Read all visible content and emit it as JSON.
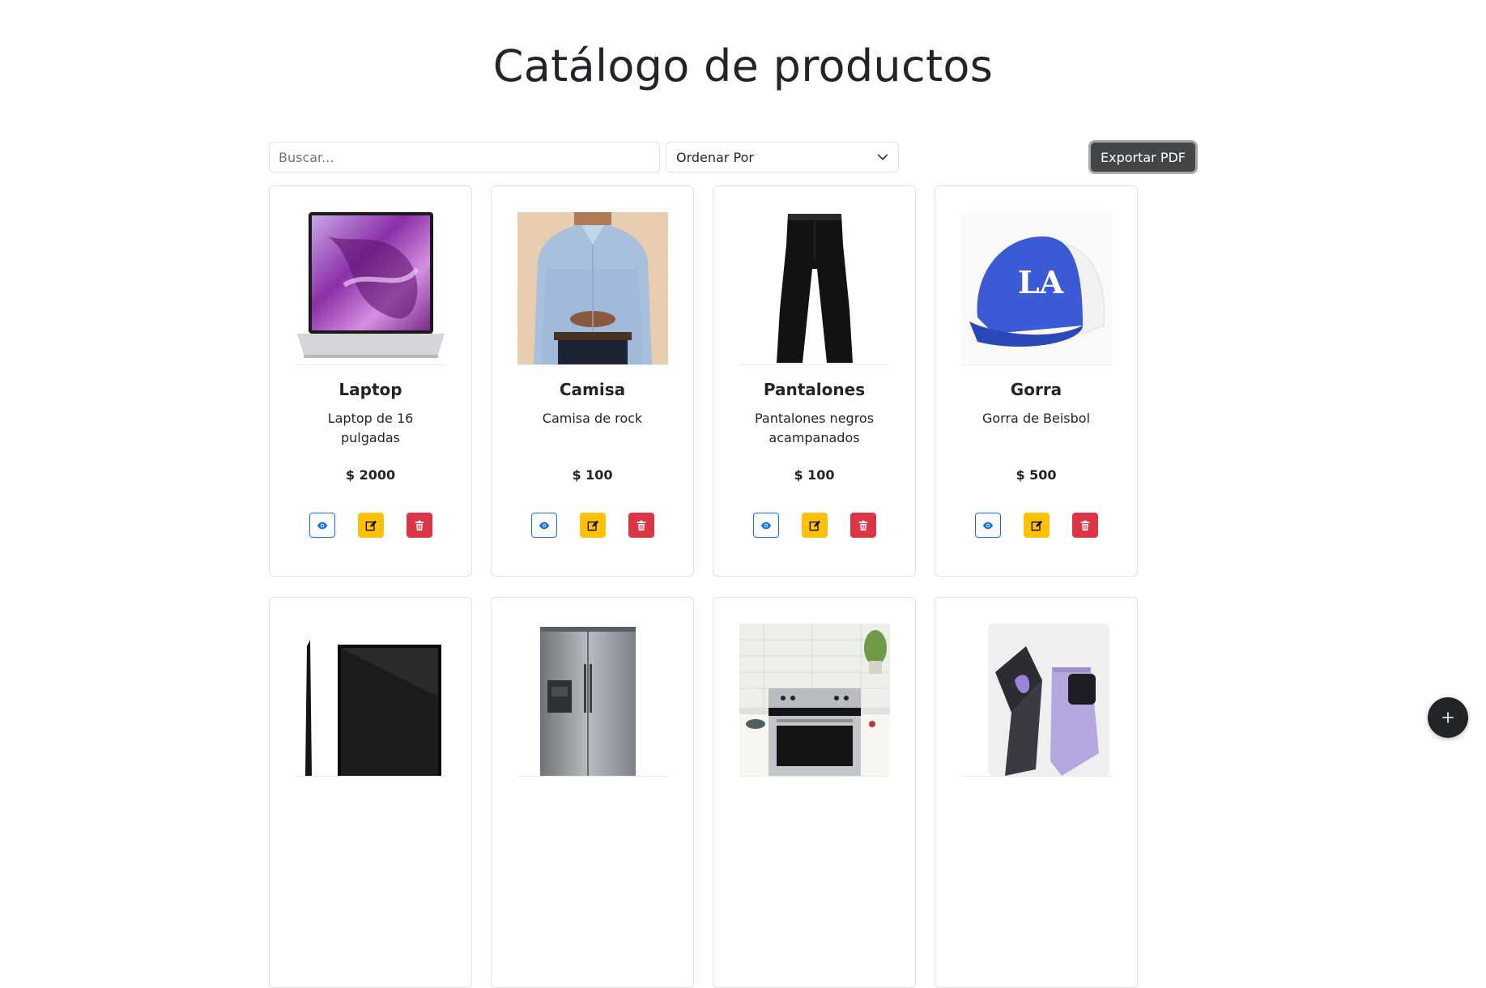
{
  "page": {
    "title": "Catálogo de productos"
  },
  "toolbar": {
    "search_placeholder": "Buscar...",
    "sort_label": "Ordenar Por",
    "export_label": "Exportar PDF"
  },
  "products": [
    {
      "name": "Laptop",
      "description": "Laptop de 16 pulgadas",
      "price": "$ 2000",
      "image": "laptop-image"
    },
    {
      "name": "Camisa",
      "description": "Camisa de rock",
      "price": "$ 100",
      "image": "shirt-image"
    },
    {
      "name": "Pantalones",
      "description": "Pantalones negros acampanados",
      "price": "$ 100",
      "image": "pants-image"
    },
    {
      "name": "Gorra",
      "description": "Gorra de Beisbol",
      "price": "$ 500",
      "image": "cap-image"
    },
    {
      "image": "tv-image"
    },
    {
      "image": "refrigerator-image"
    },
    {
      "image": "stove-image"
    },
    {
      "image": "foldable-phone-image"
    }
  ],
  "colors": {
    "view": "#0d6efd",
    "edit": "#ffc107",
    "delete": "#dc3545",
    "export_bg": "#424649",
    "fab_bg": "#212529"
  },
  "icons": {
    "view": "eye-icon",
    "edit": "pencil-square-icon",
    "delete": "trash-icon",
    "add": "plus-icon",
    "sort": "chevron-down-icon"
  }
}
